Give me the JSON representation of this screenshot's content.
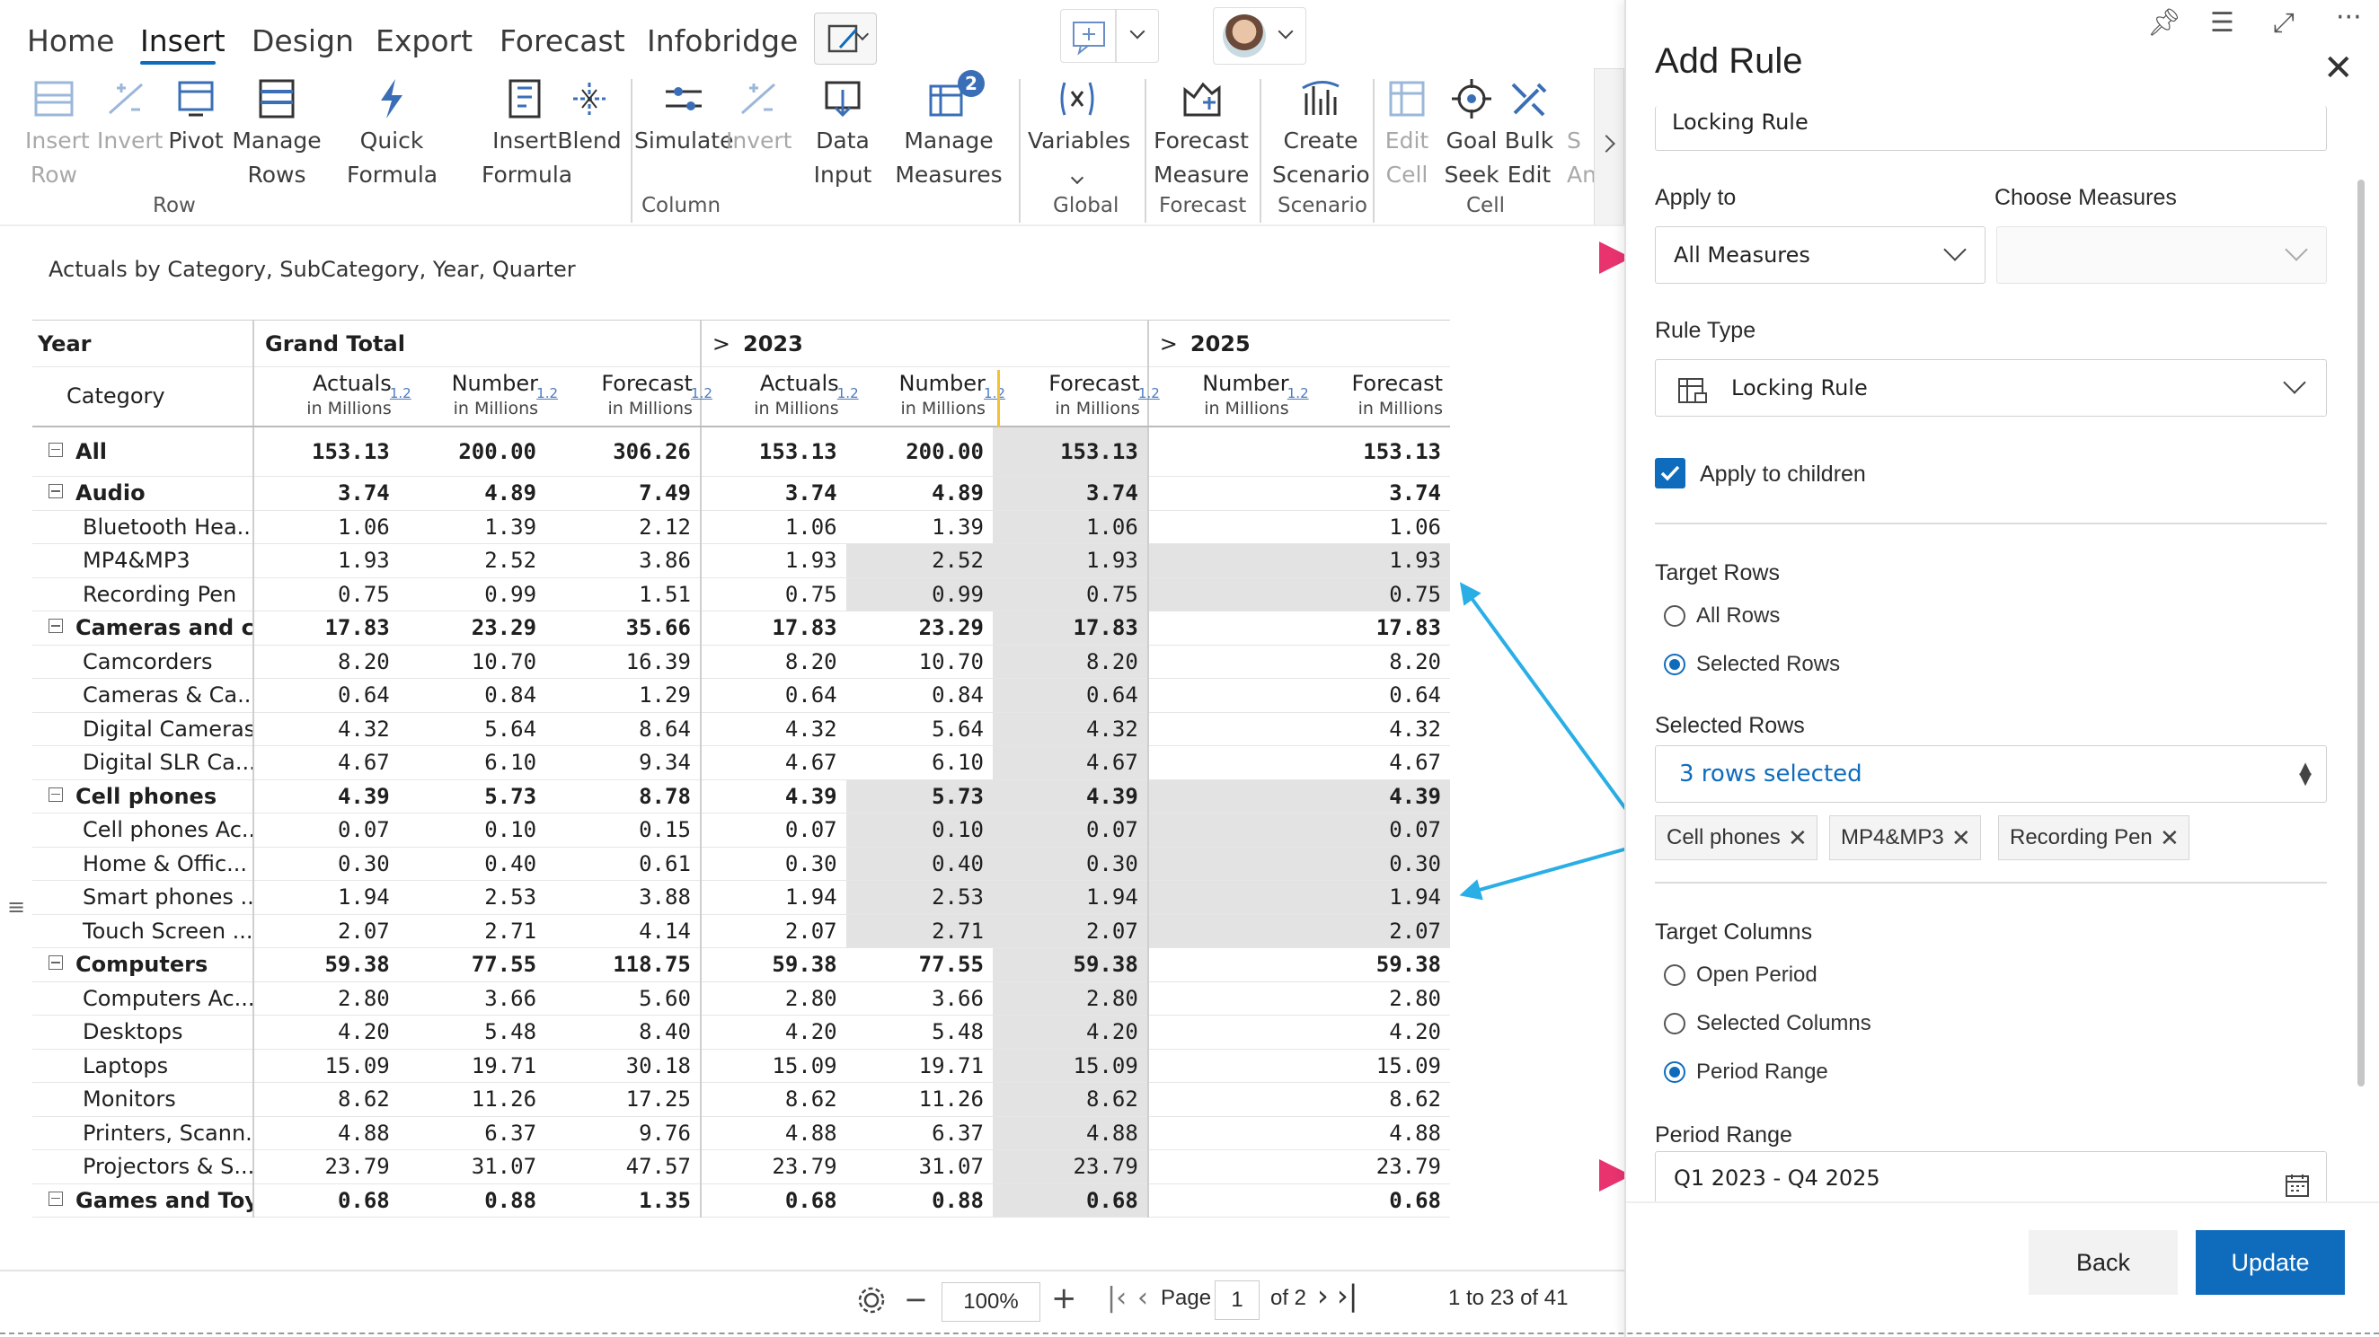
{
  "menu": {
    "tabs": [
      "Home",
      "Insert",
      "Design",
      "Export",
      "Forecast",
      "Infobridge"
    ],
    "active_tab": "Insert"
  },
  "ribbon": {
    "row": {
      "label": "Row",
      "buttons": [
        {
          "l1": "Insert",
          "l2": "Row",
          "disabled": true,
          "icon": "insert-row-icon"
        },
        {
          "l1": "Invert",
          "l2": "",
          "disabled": true,
          "icon": "invert-icon"
        },
        {
          "l1": "Pivot",
          "l2": "",
          "disabled": false,
          "icon": "pivot-icon"
        },
        {
          "l1": "Manage",
          "l2": "Rows",
          "disabled": false,
          "icon": "manage-rows-icon"
        }
      ]
    },
    "column": {
      "label": "Column",
      "buttons": [
        {
          "l1": "Quick",
          "l2": "Formula",
          "disabled": false,
          "icon": "lightning-icon"
        },
        {
          "l1": "Insert",
          "l2": "Formula",
          "disabled": false,
          "icon": "insert-formula-icon"
        },
        {
          "l1": "Blend",
          "l2": "",
          "disabled": false,
          "icon": "blend-icon"
        },
        {
          "l1": "Simulate",
          "l2": "",
          "disabled": false,
          "icon": "simulate-icon"
        },
        {
          "l1": "Invert",
          "l2": "",
          "disabled": true,
          "icon": "invert-icon"
        },
        {
          "l1": "Data",
          "l2": "Input",
          "disabled": false,
          "icon": "data-input-icon"
        },
        {
          "l1": "Manage",
          "l2": "Measures",
          "disabled": false,
          "icon": "manage-measures-icon",
          "badge": "2"
        }
      ]
    },
    "global": {
      "label": "Global",
      "buttons": [
        {
          "l1": "Variables",
          "l2": "",
          "disabled": false,
          "icon": "variables-icon"
        }
      ]
    },
    "forecast": {
      "label": "Forecast",
      "buttons": [
        {
          "l1": "Forecast",
          "l2": "Measure",
          "disabled": false,
          "icon": "forecast-measure-icon"
        }
      ]
    },
    "scenario": {
      "label": "Scenario",
      "buttons": [
        {
          "l1": "Create",
          "l2": "Scenario",
          "disabled": false,
          "icon": "create-scenario-icon"
        }
      ]
    },
    "cell": {
      "label": "Cell",
      "buttons": [
        {
          "l1": "Edit",
          "l2": "Cell",
          "disabled": true,
          "icon": "edit-cell-icon"
        },
        {
          "l1": "Goal",
          "l2": "Seek",
          "disabled": false,
          "icon": "goal-seek-icon"
        },
        {
          "l1": "Bulk",
          "l2": "Edit",
          "disabled": false,
          "icon": "bulk-edit-icon"
        }
      ]
    },
    "overflow": {
      "l1": "S",
      "l2": "An"
    }
  },
  "report": {
    "title": "Actuals by Category, SubCategory, Year, Quarter",
    "row_header_year": "Year",
    "row_header_category": "Category",
    "groups": [
      {
        "label": "Grand Total",
        "expand": ""
      },
      {
        "label": "2023",
        "expand": ">"
      },
      {
        "label": "2025",
        "expand": ">"
      }
    ],
    "columns": [
      {
        "title": "Actuals",
        "unit": "in Millions"
      },
      {
        "title": "Number",
        "unit": "in Millions"
      },
      {
        "title": "Forecast",
        "unit": "in Millions"
      },
      {
        "title": "Actuals",
        "unit": "in Millions"
      },
      {
        "title": "Number",
        "unit": "in Millions"
      },
      {
        "title": "Forecast",
        "unit": "in Millions"
      },
      {
        "title": "Number",
        "unit": "in Millions"
      },
      {
        "title": "Forecast",
        "unit": "in Millions"
      }
    ],
    "fmt_badge": "1.2",
    "rows": [
      {
        "label": "All",
        "level": 0,
        "values": [
          "153.13",
          "200.00",
          "306.26",
          "153.13",
          "200.00",
          "153.13",
          "",
          "153.13"
        ]
      },
      {
        "label": "Audio",
        "level": 0,
        "values": [
          "3.74",
          "4.89",
          "7.49",
          "3.74",
          "4.89",
          "3.74",
          "",
          "3.74"
        ]
      },
      {
        "label": "Bluetooth Hea...",
        "level": 1,
        "values": [
          "1.06",
          "1.39",
          "2.12",
          "1.06",
          "1.39",
          "1.06",
          "",
          "1.06"
        ]
      },
      {
        "label": "MP4&MP3",
        "level": 1,
        "values": [
          "1.93",
          "2.52",
          "3.86",
          "1.93",
          "2.52",
          "1.93",
          "",
          "1.93"
        ],
        "shaded": true
      },
      {
        "label": "Recording Pen",
        "level": 1,
        "values": [
          "0.75",
          "0.99",
          "1.51",
          "0.75",
          "0.99",
          "0.75",
          "",
          "0.75"
        ],
        "shaded": true
      },
      {
        "label": "Cameras and c...",
        "level": 0,
        "values": [
          "17.83",
          "23.29",
          "35.66",
          "17.83",
          "23.29",
          "17.83",
          "",
          "17.83"
        ]
      },
      {
        "label": "Camcorders",
        "level": 1,
        "values": [
          "8.20",
          "10.70",
          "16.39",
          "8.20",
          "10.70",
          "8.20",
          "",
          "8.20"
        ]
      },
      {
        "label": "Cameras & Ca...",
        "level": 1,
        "values": [
          "0.64",
          "0.84",
          "1.29",
          "0.64",
          "0.84",
          "0.64",
          "",
          "0.64"
        ]
      },
      {
        "label": "Digital Cameras",
        "level": 1,
        "values": [
          "4.32",
          "5.64",
          "8.64",
          "4.32",
          "5.64",
          "4.32",
          "",
          "4.32"
        ]
      },
      {
        "label": "Digital SLR Ca...",
        "level": 1,
        "values": [
          "4.67",
          "6.10",
          "9.34",
          "4.67",
          "6.10",
          "4.67",
          "",
          "4.67"
        ]
      },
      {
        "label": "Cell phones",
        "level": 0,
        "values": [
          "4.39",
          "5.73",
          "8.78",
          "4.39",
          "5.73",
          "4.39",
          "",
          "4.39"
        ],
        "shaded": true
      },
      {
        "label": "Cell phones Ac...",
        "level": 1,
        "values": [
          "0.07",
          "0.10",
          "0.15",
          "0.07",
          "0.10",
          "0.07",
          "",
          "0.07"
        ],
        "shaded": true
      },
      {
        "label": "Home & Offic...",
        "level": 1,
        "values": [
          "0.30",
          "0.40",
          "0.61",
          "0.30",
          "0.40",
          "0.30",
          "",
          "0.30"
        ],
        "shaded": true
      },
      {
        "label": "Smart phones ...",
        "level": 1,
        "values": [
          "1.94",
          "2.53",
          "3.88",
          "1.94",
          "2.53",
          "1.94",
          "",
          "1.94"
        ],
        "shaded": true
      },
      {
        "label": "Touch Screen ...",
        "level": 1,
        "values": [
          "2.07",
          "2.71",
          "4.14",
          "2.07",
          "2.71",
          "2.07",
          "",
          "2.07"
        ],
        "shaded": true
      },
      {
        "label": "Computers",
        "level": 0,
        "values": [
          "59.38",
          "77.55",
          "118.75",
          "59.38",
          "77.55",
          "59.38",
          "",
          "59.38"
        ]
      },
      {
        "label": "Computers Ac...",
        "level": 1,
        "values": [
          "2.80",
          "3.66",
          "5.60",
          "2.80",
          "3.66",
          "2.80",
          "",
          "2.80"
        ]
      },
      {
        "label": "Desktops",
        "level": 1,
        "values": [
          "4.20",
          "5.48",
          "8.40",
          "4.20",
          "5.48",
          "4.20",
          "",
          "4.20"
        ]
      },
      {
        "label": "Laptops",
        "level": 1,
        "values": [
          "15.09",
          "19.71",
          "30.18",
          "15.09",
          "19.71",
          "15.09",
          "",
          "15.09"
        ]
      },
      {
        "label": "Monitors",
        "level": 1,
        "values": [
          "8.62",
          "11.26",
          "17.25",
          "8.62",
          "11.26",
          "8.62",
          "",
          "8.62"
        ]
      },
      {
        "label": "Printers, Scann...",
        "level": 1,
        "values": [
          "4.88",
          "6.37",
          "9.76",
          "4.88",
          "6.37",
          "4.88",
          "",
          "4.88"
        ]
      },
      {
        "label": "Projectors & S...",
        "level": 1,
        "values": [
          "23.79",
          "31.07",
          "47.57",
          "23.79",
          "31.07",
          "23.79",
          "",
          "23.79"
        ]
      },
      {
        "label": "Games and Toys",
        "level": 0,
        "values": [
          "0.68",
          "0.88",
          "1.35",
          "0.68",
          "0.88",
          "0.68",
          "",
          "0.68"
        ]
      }
    ]
  },
  "footer": {
    "zoom": "100%",
    "page_label": "Page",
    "page_value": "1",
    "of_pages": "of 2",
    "range": "1 to 23 of 41"
  },
  "panel": {
    "title": "Add Rule",
    "rule_name": "Locking Rule",
    "apply_to_label": "Apply to",
    "apply_to_value": "All Measures",
    "choose_measures_label": "Choose Measures",
    "choose_measures_value": "",
    "rule_type_label": "Rule Type",
    "rule_type_value": "Locking Rule",
    "apply_children_label": "Apply to children",
    "target_rows_label": "Target Rows",
    "target_rows_options": [
      "All Rows",
      "Selected Rows"
    ],
    "target_rows_selected": 1,
    "selected_rows_label": "Selected Rows",
    "selected_rows_value": "3 rows selected",
    "chips": [
      "Cell phones",
      "MP4&MP3",
      "Recording Pen"
    ],
    "target_columns_label": "Target Columns",
    "target_columns_options": [
      "Open Period",
      "Selected Columns",
      "Period Range"
    ],
    "target_columns_selected": 2,
    "period_range_label": "Period Range",
    "period_range_value": "Q1 2023 - Q4 2025",
    "back_label": "Back",
    "update_label": "Update"
  },
  "colors": {
    "accent": "#0f6cbd",
    "arrow_blue": "#29aee6",
    "arrow_pink": "#e8336f",
    "shade": "#e3e3e3"
  }
}
